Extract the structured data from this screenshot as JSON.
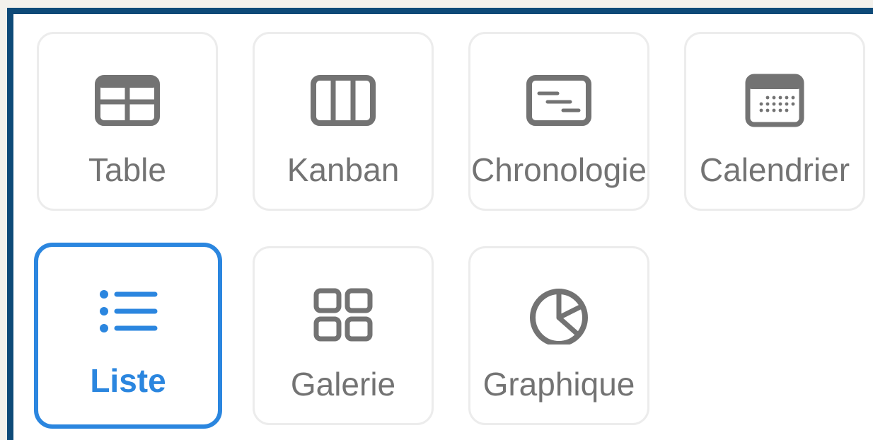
{
  "colors": {
    "frame": "#0e4a78",
    "icon": "#737373",
    "selected": "#2b86df",
    "tile_border": "#ececec"
  },
  "views": [
    {
      "label": "Table",
      "icon": "table-icon"
    },
    {
      "label": "Kanban",
      "icon": "kanban-icon"
    },
    {
      "label": "Chronologie",
      "icon": "timeline-icon"
    },
    {
      "label": "Calendrier",
      "icon": "calendar-icon"
    },
    {
      "label": "Liste",
      "icon": "list-icon",
      "selected": true
    },
    {
      "label": "Galerie",
      "icon": "gallery-icon"
    },
    {
      "label": "Graphique",
      "icon": "chart-icon"
    }
  ]
}
